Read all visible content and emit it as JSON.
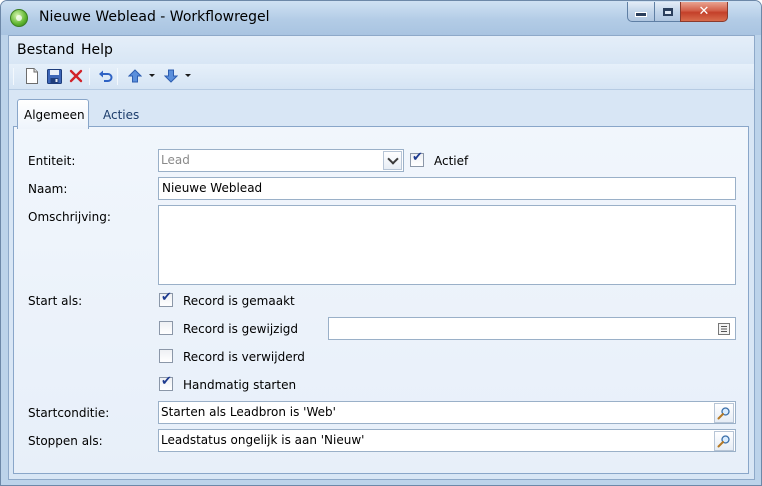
{
  "window": {
    "title": "Nieuwe Weblead - Workflowregel",
    "controls": {
      "minimize": "minimize",
      "maximize": "maximize",
      "close": "✕"
    }
  },
  "menu": {
    "file": "Bestand",
    "help": "Help"
  },
  "toolbar": {
    "icons": [
      "new-document-icon",
      "save-icon",
      "delete-icon",
      "undo-icon",
      "arrow-up-icon",
      "arrow-down-icon"
    ]
  },
  "tabs": [
    {
      "label": "Algemeen",
      "active": true
    },
    {
      "label": "Acties",
      "active": false
    }
  ],
  "form": {
    "entity": {
      "label": "Entiteit:",
      "value": "Lead",
      "enabled": false
    },
    "active": {
      "label": "Actief",
      "checked": true
    },
    "name": {
      "label": "Naam:",
      "value": "Nieuwe Weblead"
    },
    "description": {
      "label": "Omschrijving:",
      "value": ""
    },
    "start_as": {
      "label": "Start als:",
      "options": [
        {
          "label": "Record is gemaakt",
          "checked": true
        },
        {
          "label": "Record is gewijzigd",
          "checked": false
        },
        {
          "label": "Record is verwijderd",
          "checked": false
        },
        {
          "label": "Handmatig starten",
          "checked": true
        }
      ],
      "changed_fields_value": ""
    },
    "start_condition": {
      "label": "Startconditie:",
      "value": "Starten als Leadbron is 'Web'"
    },
    "stop_when": {
      "label": "Stoppen als:",
      "value": "Leadstatus ongelijk is aan 'Nieuw'"
    }
  },
  "colors": {
    "title_bar": "#b3cce6",
    "client_background": "#d8e6f5",
    "panel_background": "#eef4fb",
    "close_button": "#c4402a",
    "check_mark": "#1d3a8f"
  }
}
